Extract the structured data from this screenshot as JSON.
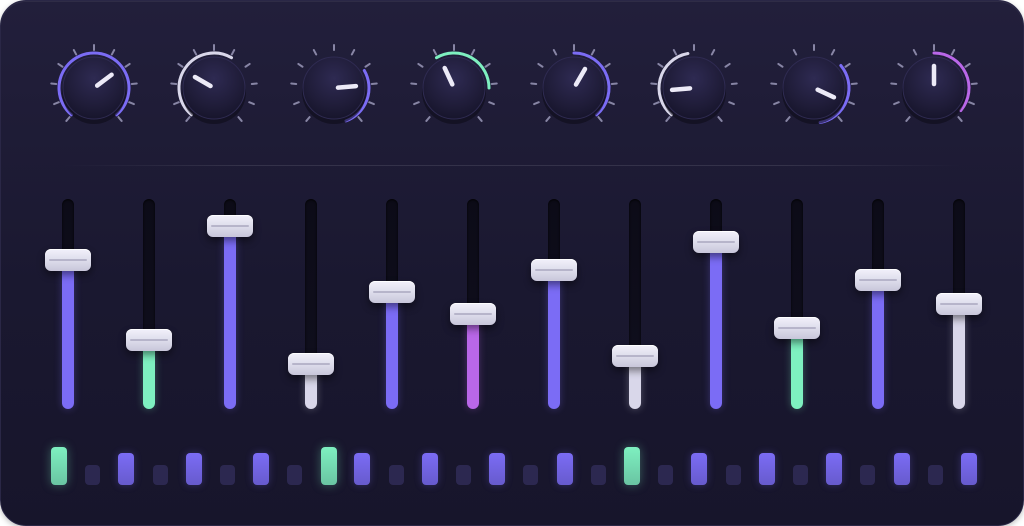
{
  "colors": {
    "purple": "#7b6cf5",
    "green": "#7ef0c0",
    "magenta": "#b967e8",
    "white": "#d9d7ea",
    "step_off": "#2c2850",
    "knob_body": "#221f3c",
    "tick": "#9a98b8"
  },
  "knobs": [
    {
      "pointer_angle": 53,
      "arc": [
        -140,
        140
      ],
      "arc_color": "purple"
    },
    {
      "pointer_angle": -60,
      "arc": [
        -140,
        30
      ],
      "arc_color": "white"
    },
    {
      "pointer_angle": 85,
      "arc": [
        60,
        160
      ],
      "arc_color": "purple"
    },
    {
      "pointer_angle": -25,
      "arc": [
        -30,
        90
      ],
      "arc_color": "green"
    },
    {
      "pointer_angle": 30,
      "arc": [
        0,
        140
      ],
      "arc_color": "purple"
    },
    {
      "pointer_angle": -95,
      "arc": [
        -140,
        -10
      ],
      "arc_color": "white"
    },
    {
      "pointer_angle": 115,
      "arc": [
        50,
        170
      ],
      "arc_color": "purple"
    },
    {
      "pointer_angle": 0,
      "arc": [
        0,
        130
      ],
      "arc_color": "magenta"
    }
  ],
  "faders": [
    {
      "level": 0.72,
      "color": "purple"
    },
    {
      "level": 0.32,
      "color": "green"
    },
    {
      "level": 0.89,
      "color": "purple"
    },
    {
      "level": 0.2,
      "color": "white"
    },
    {
      "level": 0.56,
      "color": "purple"
    },
    {
      "level": 0.45,
      "color": "magenta"
    },
    {
      "level": 0.67,
      "color": "purple"
    },
    {
      "level": 0.24,
      "color": "white"
    },
    {
      "level": 0.81,
      "color": "purple"
    },
    {
      "level": 0.38,
      "color": "green"
    },
    {
      "level": 0.62,
      "color": "purple"
    },
    {
      "level": 0.5,
      "color": "white"
    }
  ],
  "steps": [
    {
      "on": true,
      "color": "green"
    },
    {
      "on": false
    },
    {
      "on": true,
      "color": "purple"
    },
    {
      "on": false
    },
    {
      "on": true,
      "color": "purple"
    },
    {
      "on": false
    },
    {
      "on": true,
      "color": "purple"
    },
    {
      "on": false
    },
    {
      "on": true,
      "color": "green"
    },
    {
      "on": true,
      "color": "purple"
    },
    {
      "on": false
    },
    {
      "on": true,
      "color": "purple"
    },
    {
      "on": false
    },
    {
      "on": true,
      "color": "purple"
    },
    {
      "on": false
    },
    {
      "on": true,
      "color": "purple"
    },
    {
      "on": false
    },
    {
      "on": true,
      "color": "green"
    },
    {
      "on": false
    },
    {
      "on": true,
      "color": "purple"
    },
    {
      "on": false
    },
    {
      "on": true,
      "color": "purple"
    },
    {
      "on": false
    },
    {
      "on": true,
      "color": "purple"
    },
    {
      "on": false
    },
    {
      "on": true,
      "color": "purple"
    },
    {
      "on": false
    },
    {
      "on": true,
      "color": "purple"
    }
  ]
}
